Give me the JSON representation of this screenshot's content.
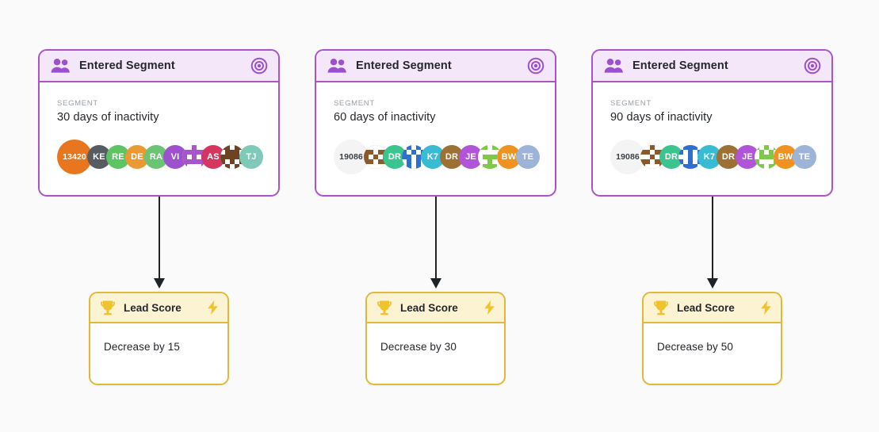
{
  "canvas": {
    "background_color": "#fafafa"
  },
  "palette": {
    "segment_border": "#a855c9",
    "segment_header_bg": "#f5e7fa",
    "segment_icon": "#9b4fd1",
    "score_border": "#e0b93a",
    "score_header_bg": "#fcf3d3",
    "score_icon": "#efc22e",
    "connector": "#1f2226",
    "label_text": "#9aa0a6",
    "value_text": "#24272b"
  },
  "branches": [
    {
      "trigger": {
        "title": "Entered Segment",
        "icon": "people-icon",
        "badge_icon": "target-icon",
        "field_label": "SEGMENT",
        "field_value": "30 days of inactivity",
        "avatars": [
          {
            "type": "count",
            "label": "13420",
            "color": "#e8761e",
            "size": "big"
          },
          {
            "type": "initial",
            "label": "KE",
            "color": "#575c60"
          },
          {
            "type": "initial",
            "label": "RE",
            "color": "#5dc464"
          },
          {
            "type": "initial",
            "label": "DE",
            "color": "#eb9a33"
          },
          {
            "type": "initial",
            "label": "RA",
            "color": "#6ac473"
          },
          {
            "type": "initial",
            "label": "VI",
            "color": "#9d51cf"
          },
          {
            "type": "pattern",
            "label": "",
            "color": "#a855c9"
          },
          {
            "type": "initial",
            "label": "AS",
            "color": "#d4365f"
          },
          {
            "type": "pattern",
            "label": "",
            "color": "#6e4323"
          },
          {
            "type": "initial",
            "label": "TJ",
            "color": "#7ec9b8"
          }
        ]
      },
      "action": {
        "title": "Lead Score",
        "icon": "trophy-icon",
        "badge_icon": "lightning-icon",
        "field_value": "Decrease by 15"
      }
    },
    {
      "trigger": {
        "title": "Entered Segment",
        "icon": "people-icon",
        "badge_icon": "target-icon",
        "field_label": "SEGMENT",
        "field_value": "60 days of inactivity",
        "avatars": [
          {
            "type": "count",
            "label": "19086",
            "color": "#f4f4f4",
            "size": "pale"
          },
          {
            "type": "pattern",
            "label": "",
            "color": "#8a5a2b"
          },
          {
            "type": "initial",
            "label": "DR",
            "color": "#3cc48e"
          },
          {
            "type": "pattern",
            "label": "",
            "color": "#2f6fd0"
          },
          {
            "type": "initial",
            "label": "K7",
            "color": "#37bcd4"
          },
          {
            "type": "initial",
            "label": "DR",
            "color": "#9d7034"
          },
          {
            "type": "initial",
            "label": "JE",
            "color": "#b155d8"
          },
          {
            "type": "pattern",
            "label": "",
            "color": "#7ec94a"
          },
          {
            "type": "initial",
            "label": "BW",
            "color": "#ef921f"
          },
          {
            "type": "initial",
            "label": "TE",
            "color": "#9db4d8"
          }
        ]
      },
      "action": {
        "title": "Lead Score",
        "icon": "trophy-icon",
        "badge_icon": "lightning-icon",
        "field_value": "Decrease by 30"
      }
    },
    {
      "trigger": {
        "title": "Entered Segment",
        "icon": "people-icon",
        "badge_icon": "target-icon",
        "field_label": "SEGMENT",
        "field_value": "90 days of inactivity",
        "avatars": [
          {
            "type": "count",
            "label": "19086",
            "color": "#f4f4f4",
            "size": "pale"
          },
          {
            "type": "pattern",
            "label": "",
            "color": "#8a5a2b"
          },
          {
            "type": "initial",
            "label": "DR",
            "color": "#3cc48e"
          },
          {
            "type": "pattern",
            "label": "",
            "color": "#2f6fd0"
          },
          {
            "type": "initial",
            "label": "K7",
            "color": "#37bcd4"
          },
          {
            "type": "initial",
            "label": "DR",
            "color": "#9d7034"
          },
          {
            "type": "initial",
            "label": "JE",
            "color": "#b155d8"
          },
          {
            "type": "pattern",
            "label": "",
            "color": "#7ec94a"
          },
          {
            "type": "initial",
            "label": "BW",
            "color": "#ef921f"
          },
          {
            "type": "initial",
            "label": "TE",
            "color": "#9db4d8"
          }
        ]
      },
      "action": {
        "title": "Lead Score",
        "icon": "trophy-icon",
        "badge_icon": "lightning-icon",
        "field_value": "Decrease by 50"
      }
    }
  ]
}
